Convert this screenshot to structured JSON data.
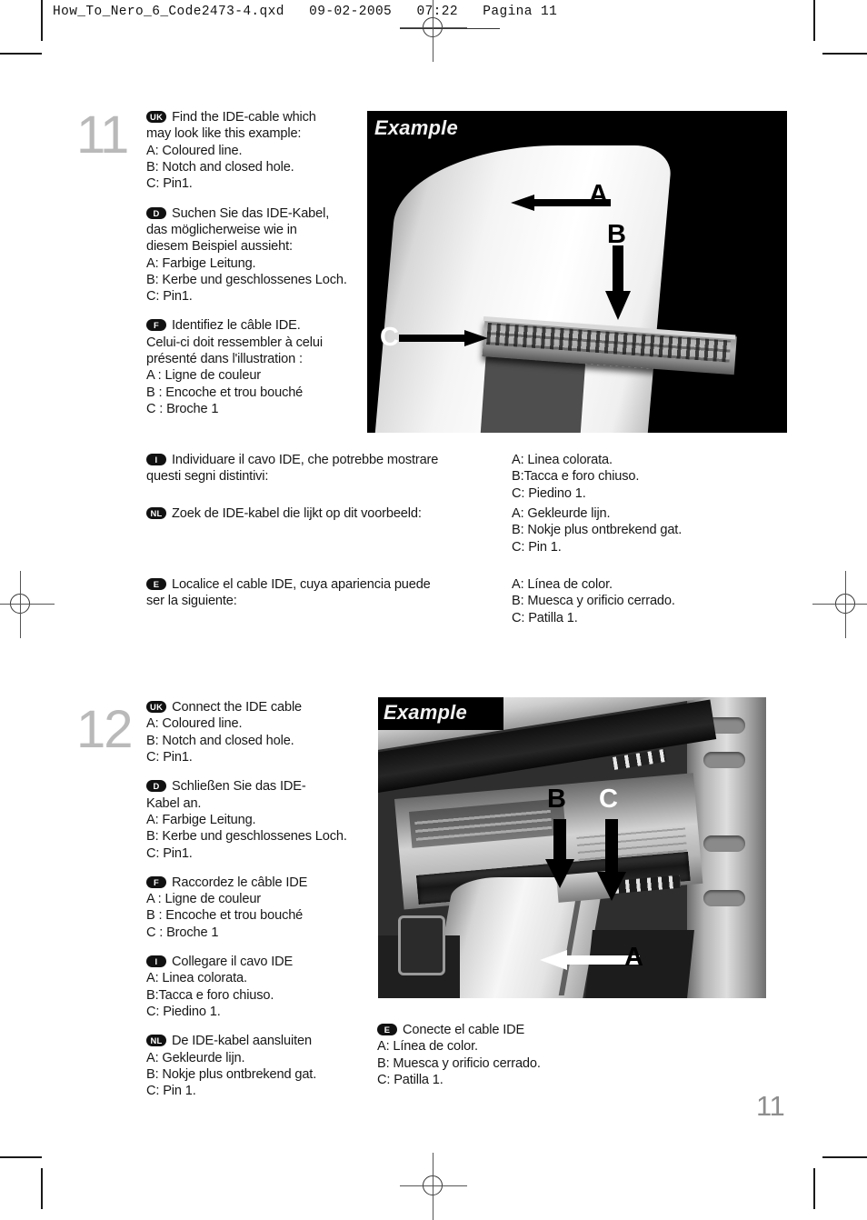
{
  "prepress": {
    "slug": "How_To_Nero_6_Code2473-4.qxd   09-02-2005   07:22   Pagina 11"
  },
  "page": {
    "number": "11"
  },
  "steps": [
    {
      "number": "11",
      "left_column": [
        {
          "flag": "UK",
          "lines": [
            "Find the IDE-cable which",
            "may look like this example:",
            "A: Coloured line.",
            "B: Notch and closed hole.",
            "C: Pin1."
          ]
        },
        {
          "flag": "D",
          "lines": [
            "Suchen Sie das IDE-Kabel,",
            "das möglicherweise wie in",
            "diesem Beispiel aussieht:",
            "A: Farbige Leitung.",
            "B: Kerbe und geschlossenes Loch.",
            "C: Pin1."
          ]
        },
        {
          "flag": "F",
          "lines": [
            "Identifiez le câble IDE.",
            "Celui-ci doit ressembler à celui",
            "présenté dans l'illustration :",
            "A : Ligne de couleur",
            "B : Encoche et trou bouché",
            "C : Broche 1"
          ]
        }
      ],
      "wide_rows": [
        {
          "flag": "I",
          "lines": [
            "Individuare il cavo IDE, che potrebbe mostrare",
            "questi segni distintivi:"
          ],
          "right_lines": [
            "A: Linea colorata.",
            "B:Tacca e foro chiuso.",
            "C: Piedino 1."
          ]
        },
        {
          "flag": "NL",
          "lines": [
            "Zoek de IDE-kabel die lijkt op dit voorbeeld:"
          ],
          "right_lines": [
            "A: Gekleurde lijn.",
            "B: Nokje plus ontbrekend gat.",
            "C: Pin 1."
          ]
        },
        {
          "flag": "E",
          "lines": [
            "Localice el cable IDE, cuya apariencia puede",
            "ser la siguiente:"
          ],
          "right_lines": [
            "A: Línea de color.",
            "B: Muesca y orificio cerrado.",
            "C: Patilla 1."
          ]
        }
      ],
      "photo": {
        "caption": "Example",
        "callouts": [
          "A",
          "B",
          "C"
        ]
      }
    },
    {
      "number": "12",
      "left_column": [
        {
          "flag": "UK",
          "lines": [
            "Connect the IDE cable",
            "A: Coloured line.",
            "B: Notch and closed hole.",
            "C: Pin1."
          ]
        },
        {
          "flag": "D",
          "lines": [
            "Schließen Sie das IDE-",
            "Kabel an.",
            "A: Farbige Leitung.",
            "B: Kerbe und geschlossenes Loch.",
            "C: Pin1."
          ]
        },
        {
          "flag": "F",
          "lines": [
            "Raccordez le câble IDE",
            "A : Ligne de couleur",
            "B : Encoche et trou bouché",
            "C : Broche 1"
          ]
        },
        {
          "flag": "I",
          "lines": [
            "Collegare il cavo IDE",
            "A: Linea colorata.",
            "B:Tacca e foro chiuso.",
            "C: Piedino 1."
          ]
        },
        {
          "flag": "NL",
          "lines": [
            "De IDE-kabel aansluiten",
            "A: Gekleurde lijn.",
            "B: Nokje plus ontbrekend gat.",
            "C: Pin 1."
          ]
        }
      ],
      "right_column": [
        {
          "flag": "E",
          "lines": [
            "Conecte el cable IDE",
            "A: Línea de color.",
            "B: Muesca y orificio cerrado.",
            "C: Patilla 1."
          ]
        }
      ],
      "photo": {
        "caption": "Example",
        "callouts": [
          "B",
          "C",
          "A"
        ]
      }
    }
  ],
  "colors": {
    "step_number": "#b9b9b9",
    "body_text": "#171717",
    "flag_bg": "#111111",
    "flag_fg": "#ffffff",
    "page_number": "#8d8d8d",
    "photo_bg": "#000000"
  }
}
